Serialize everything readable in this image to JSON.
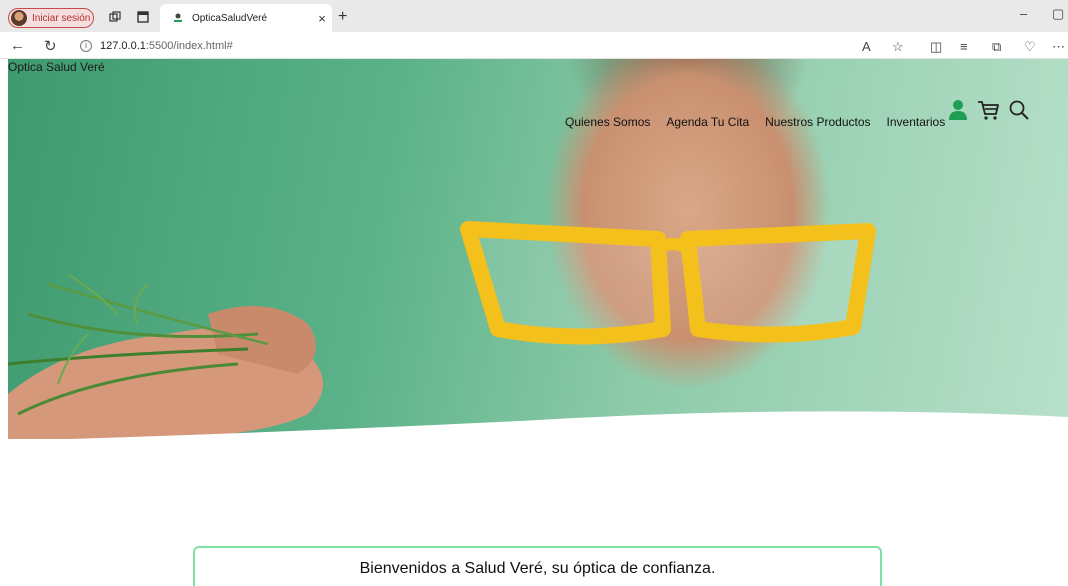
{
  "browser": {
    "profile_label": "Iniciar sesión",
    "tab_title": "OpticaSaludVeré",
    "url_host": "127.0.0.1",
    "url_rest": ":5500/index.html#"
  },
  "site": {
    "brand": "Optica Salud Veré",
    "nav": [
      {
        "label": "Quienes Somos"
      },
      {
        "label": "Agenda Tu Cita"
      },
      {
        "label": "Nuestros Productos"
      },
      {
        "label": "Inventarios"
      }
    ],
    "icons": [
      "user-icon",
      "cart-icon",
      "search-icon"
    ],
    "accent_color": "#1f9d55",
    "welcome_text": "Bienvenidos a Salud Veré, su óptica de confianza."
  }
}
